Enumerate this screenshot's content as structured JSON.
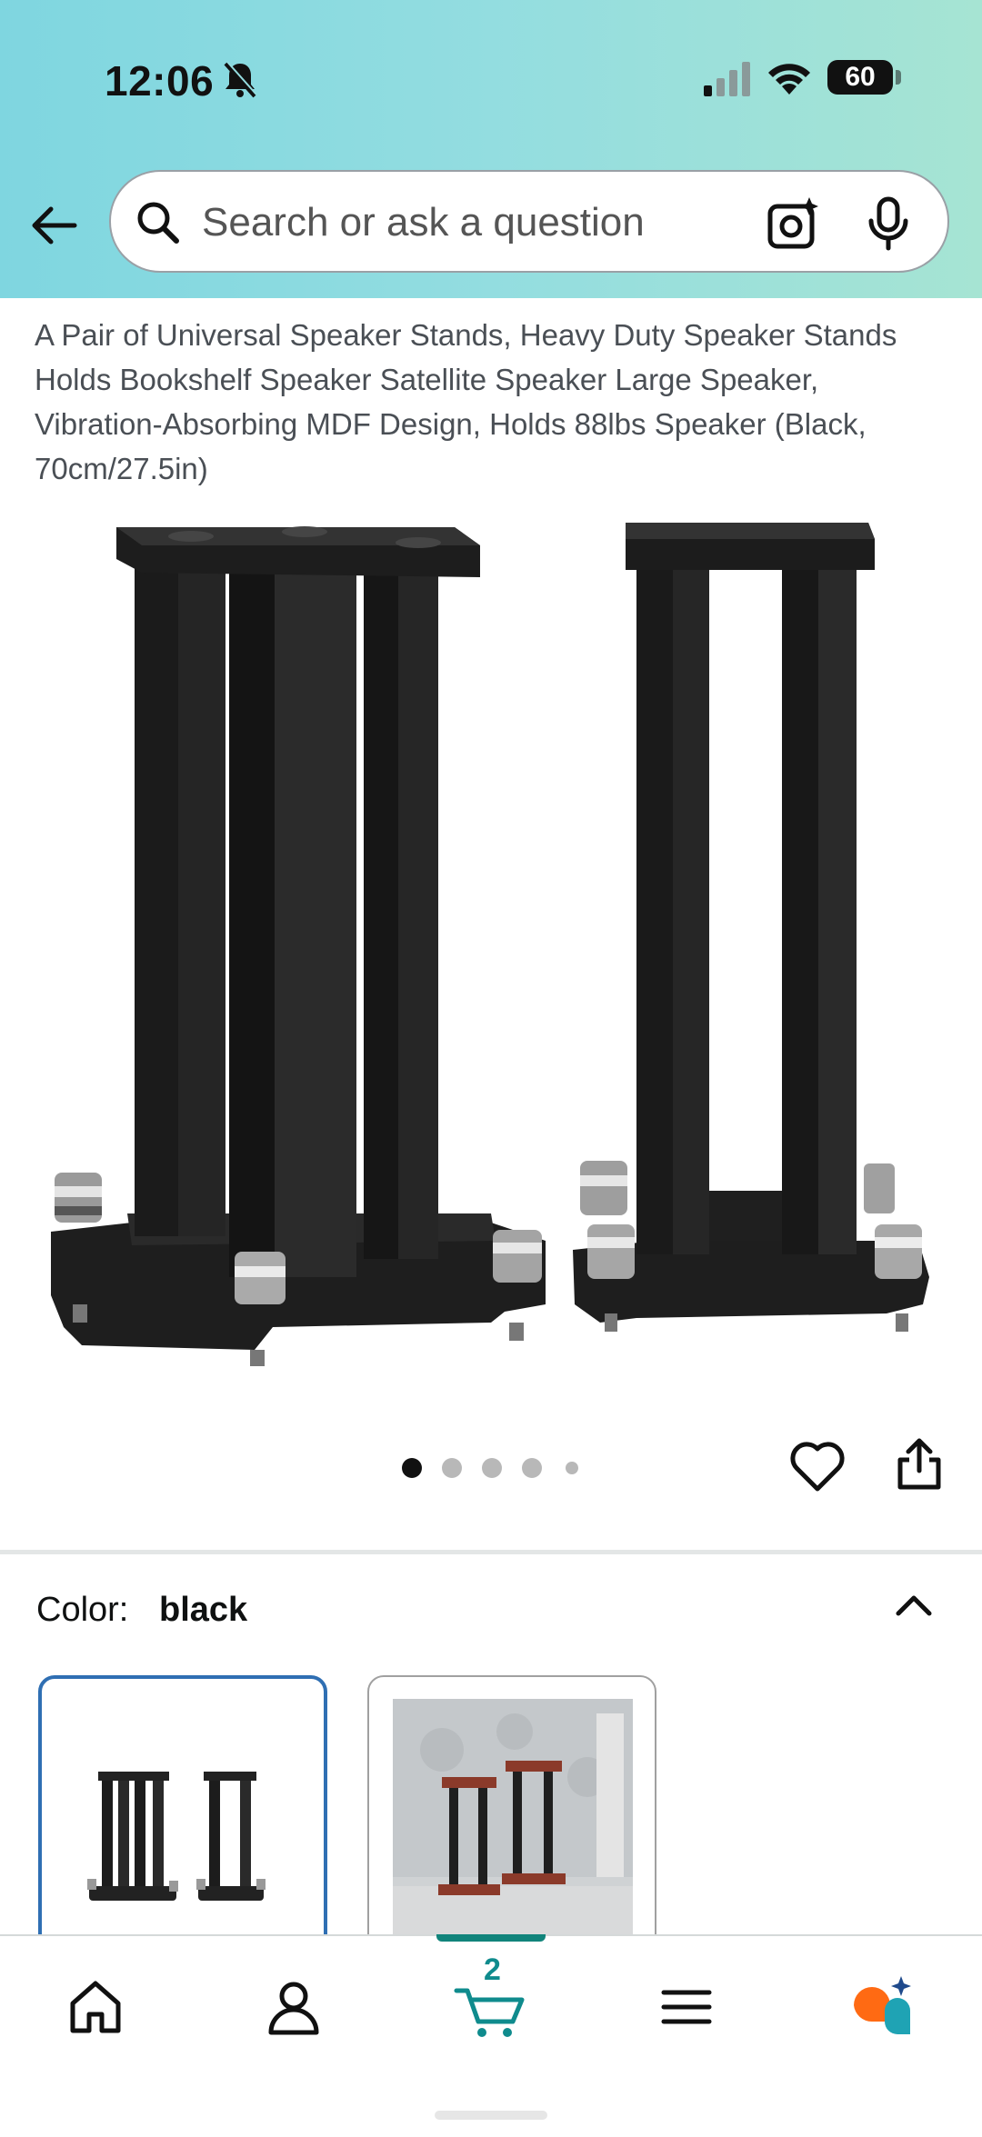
{
  "status_bar": {
    "time": "12:06",
    "battery": "60"
  },
  "search": {
    "placeholder": "Search or ask a question"
  },
  "product": {
    "title": "A Pair of Universal Speaker Stands, Heavy Duty Speaker Stands Holds Bookshelf Speaker Satellite Speaker Large Speaker, Vibration-Absorbing MDF Design, Holds 88lbs Speaker (Black, 70cm/27.5in)",
    "gallery": {
      "image_count": 5,
      "active_index": 0
    }
  },
  "variation": {
    "label": "Color:",
    "value": "black",
    "options": [
      "black",
      "red/brown"
    ]
  },
  "bottom_nav": {
    "items": [
      "home",
      "account",
      "cart",
      "menu",
      "rufus"
    ],
    "active": "cart",
    "cart_count": "2"
  },
  "colors": {
    "accent_teal": "#0f8b8d",
    "selected_border": "#2f6fb3",
    "header_gradient_start": "#7fd6e0",
    "header_gradient_end": "#a6e4d3"
  }
}
